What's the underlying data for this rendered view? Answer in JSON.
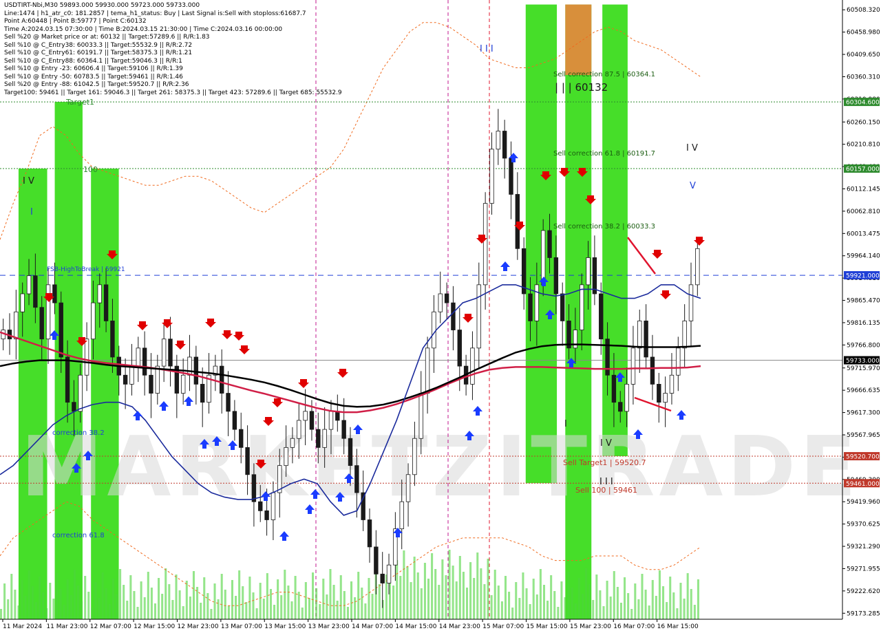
{
  "info": {
    "lines": [
      "USDTIRT-Nbi,M30  59893.000 59930.000 59723.000 59733.000",
      "Line:1474 | h1_atr_c0: 181.2857 | tema_h1_status: Buy | Last Signal is:Sell with stoploss:61687.7",
      "Point A:60448 | Point B:59777 | Point C:60132",
      "Time A:2024.03.15 07:30:00 | Time B:2024.03.15 21:30:00 | Time C:2024.03.16 00:00:00",
      "Sell %20 @ Market price or at: 60132 || Target:57289.6 || R/R:1.83",
      "Sell %10 @ C_Entry38: 60033.3 || Target:55532.9 || R/R:2.72",
      "Sell %10 @ C_Entry61: 60191.7 || Target:58375.3 || R/R:1.21",
      "Sell %10 @ C_Entry88: 60364.1 || Target:59046.3 || R/R:1",
      "Sell %10 @ Entry -23: 60606.4 || Target:59106 || R/R:1.39",
      "Sell %10 @ Entry -50: 60783.5 || Target:59461 || R/R:1.46",
      "Sell %20 @ Entry -88: 61042.5 || Target:59520.7 || R/R:2.36",
      "Target100: 59461 || Target 161: 59046.3 || Target 261: 58375.3 || Target 423: 57289.6 || Target 685: 55532.9"
    ]
  },
  "watermark": "MARKETZITRADE",
  "labels": {
    "fsb": "FSB-HighToBreak | 59921",
    "sell_corr_875": "Sell correction 87.5 | 60364.1",
    "big_abc": "| | | 60132",
    "sell_corr_618": "Sell correction 61.8 | 60191.7",
    "sell_corr_382": "Sell correction 38.2 | 60033.3",
    "sell_target1": "Sell Target1 | 59520.7",
    "sell_100": "Sell 100 | 59461",
    "corr_382": "correction 38.2",
    "corr_618": "correction 61.8",
    "target1": "Target1",
    "hundred": "100",
    "wave_iv_left": "I V",
    "wave_i_left": "I",
    "wave_iii_top": "I I I",
    "wave_iv_right": "I V",
    "wave_v_right": "V",
    "wave_i_mid": "I",
    "wave_iv_mid": "I V",
    "wave_iii_mid": "I I I"
  },
  "chart_data": {
    "type": "candlestick",
    "symbol": "USDTIRT-Nbi",
    "timeframe": "M30",
    "ohlc_last": {
      "open": 59893.0,
      "high": 59930.0,
      "low": 59723.0,
      "close": 59733.0
    },
    "ylim": [
      59160,
      60530
    ],
    "y_ticks": [
      60508.32,
      60458.98,
      60409.65,
      60360.31,
      60310.98,
      60260.15,
      60210.81,
      60161.48,
      60112.145,
      60062.81,
      60013.475,
      59964.14,
      59914.81,
      59865.47,
      59816.135,
      59766.8,
      59715.97,
      59666.635,
      59617.3,
      59567.965,
      59518.63,
      59469.3,
      59419.96,
      59370.625,
      59321.29,
      59271.955,
      59222.62,
      59173.285
    ],
    "y_tick_labels": [
      "60508.320",
      "60458.980",
      "60409.650",
      "60360.310",
      "60310.980",
      "60260.150",
      "60210.810",
      "60161.480",
      "60112.145",
      "60062.810",
      "60013.475",
      "59964.140",
      "59914.810",
      "59865.470",
      "59816.135",
      "59766.800",
      "59715.970",
      "59666.635",
      "59617.300",
      "59567.965",
      "59518.630",
      "59469.300",
      "59419.960",
      "59370.625",
      "59321.290",
      "59271.955",
      "59222.620",
      "59173.285"
    ],
    "x_tick_labels": [
      "11 Mar 2024",
      "11 Mar 23:00",
      "12 Mar 07:00",
      "12 Mar 15:00",
      "12 Mar 23:00",
      "13 Mar 07:00",
      "13 Mar 15:00",
      "13 Mar 23:00",
      "14 Mar 07:00",
      "14 Mar 15:00",
      "14 Mar 23:00",
      "15 Mar 07:00",
      "15 Mar 15:00",
      "15 Mar 23:00",
      "16 Mar 07:00",
      "16 Mar 15:00"
    ],
    "price_tags": [
      {
        "value": 60304.6,
        "label": "60304.600",
        "color": "#2e8b2e"
      },
      {
        "value": 60157.0,
        "label": "60157.000",
        "color": "#2e8b2e"
      },
      {
        "value": 59921.0,
        "label": "59921.000",
        "color": "#1f3fd6"
      },
      {
        "value": 59733.0,
        "label": "59733.000",
        "color": "#000000"
      },
      {
        "value": 59520.7,
        "label": "59520.700",
        "color": "#c0392b"
      },
      {
        "value": 59461.0,
        "label": "59461.000",
        "color": "#c0392b"
      }
    ],
    "levels": [
      {
        "value": 60304.6,
        "color": "#2e8b2e",
        "style": "dotted"
      },
      {
        "value": 60157.0,
        "color": "#2e8b2e",
        "style": "dotted"
      },
      {
        "value": 59921.0,
        "color": "#1f3fd6",
        "style": "dashed"
      },
      {
        "value": 59733.0,
        "color": "#888888",
        "style": "solid"
      },
      {
        "value": 59520.7,
        "color": "#c0392b",
        "style": "dotted"
      },
      {
        "value": 59461.0,
        "color": "#c0392b",
        "style": "dotted"
      }
    ],
    "series": [
      {
        "name": "close",
        "values": [
          59800,
          59780,
          59840,
          59880,
          59920,
          59850,
          59780,
          59900,
          59860,
          59740,
          59640,
          59620,
          59700,
          59780,
          59860,
          59900,
          59820,
          59740,
          59700,
          59680,
          59720,
          59760,
          59700,
          59660,
          59720,
          59780,
          59720,
          59660,
          59700,
          59740,
          59680,
          59640,
          59700,
          59720,
          59660,
          59620,
          59580,
          59540,
          59480,
          59420,
          59400,
          59380,
          59440,
          59500,
          59540,
          59560,
          59600,
          59620,
          59580,
          59540,
          59580,
          59620,
          59600,
          59560,
          59500,
          59440,
          59380,
          59320,
          59260,
          59240,
          59280,
          59360,
          59420,
          59480,
          59560,
          59660,
          59760,
          59840,
          59880,
          59860,
          59800,
          59720,
          59680,
          59760,
          59900,
          60080,
          60200,
          60240,
          60180,
          60100,
          59980,
          59880,
          59820,
          59900,
          60020,
          59960,
          59880,
          59820,
          59760,
          59800,
          59900,
          59960,
          59880,
          59780,
          59700,
          59640,
          59620,
          59680,
          59760,
          59820,
          59740,
          59680,
          59640,
          59660,
          59700,
          59760,
          59820,
          59900,
          59980
        ]
      },
      {
        "name": "ma_black",
        "values": [
          59720,
          59726,
          59730,
          59733,
          59733,
          59733,
          59730,
          59727,
          59723,
          59720,
          59718,
          59716,
          59714,
          59712,
          59710,
          59707,
          59704,
          59700,
          59695,
          59690,
          59684,
          59676,
          59667,
          59657,
          59647,
          59638,
          59632,
          59630,
          59631,
          59635,
          59642,
          59651,
          59661,
          59672,
          59685,
          59698,
          59712,
          59725,
          59738,
          59750,
          59758,
          59764,
          59767,
          59768,
          59768,
          59767,
          59766,
          59765,
          59763,
          59762,
          59762,
          59762,
          59763,
          59765
        ]
      },
      {
        "name": "ma_red",
        "values": [
          59795,
          59785,
          59775,
          59765,
          59755,
          59745,
          59737,
          59731,
          59727,
          59724,
          59721,
          59718,
          59714,
          59709,
          59704,
          59698,
          59690,
          59682,
          59674,
          59666,
          59659,
          59651,
          59643,
          59635,
          59627,
          59621,
          59618,
          59618,
          59622,
          59628,
          59636,
          59646,
          59657,
          59669,
          59682,
          59694,
          59704,
          59712,
          59716,
          59718,
          59718,
          59718,
          59717,
          59716,
          59715,
          59714,
          59714,
          59714,
          59715,
          59715,
          59716,
          59716,
          59717,
          59720
        ]
      },
      {
        "name": "ma_blue",
        "values": [
          59480,
          59500,
          59530,
          59560,
          59590,
          59610,
          59625,
          59635,
          59640,
          59640,
          59630,
          59600,
          59560,
          59520,
          59490,
          59460,
          59440,
          59430,
          59425,
          59425,
          59432,
          59445,
          59460,
          59470,
          59460,
          59420,
          59390,
          59400,
          59460,
          59530,
          59600,
          59680,
          59760,
          59800,
          59830,
          59860,
          59870,
          59885,
          59900,
          59900,
          59890,
          59880,
          59875,
          59880,
          59890,
          59890,
          59880,
          59870,
          59870,
          59880,
          59900,
          59900,
          59880,
          59870
        ]
      },
      {
        "name": "channel_upper",
        "values": [
          60000,
          60080,
          60150,
          60230,
          60250,
          60230,
          60190,
          60160,
          60150,
          60140,
          60130,
          60120,
          60120,
          60130,
          60140,
          60140,
          60130,
          60110,
          60090,
          60070,
          60060,
          60080,
          60100,
          60120,
          60140,
          60160,
          60200,
          60260,
          60320,
          60380,
          60420,
          60460,
          60480,
          60480,
          60470,
          60450,
          60430,
          60400,
          60390,
          60380,
          60380,
          60390,
          60400,
          60420,
          60440,
          60460,
          60470,
          60460,
          60440,
          60430,
          60420,
          60400,
          60380,
          60360
        ]
      },
      {
        "name": "channel_lower",
        "values": [
          59300,
          59340,
          59360,
          59380,
          59400,
          59420,
          59410,
          59380,
          59360,
          59340,
          59320,
          59300,
          59280,
          59260,
          59240,
          59220,
          59200,
          59190,
          59190,
          59200,
          59210,
          59220,
          59220,
          59210,
          59200,
          59190,
          59190,
          59200,
          59220,
          59240,
          59260,
          59280,
          59300,
          59320,
          59330,
          59340,
          59340,
          59340,
          59340,
          59330,
          59320,
          59300,
          59290,
          59290,
          59290,
          59300,
          59300,
          59300,
          59280,
          59270,
          59270,
          59280,
          59300,
          59320
        ]
      }
    ],
    "zones": [
      {
        "x0": 0.022,
        "x1": 0.056,
        "y0": 60157.0,
        "y1": 59160,
        "color": "#3cdc1e"
      },
      {
        "x0": 0.065,
        "x1": 0.098,
        "y0": 60304.6,
        "y1": 59160,
        "color": "#3cdc1e"
      },
      {
        "x0": 0.108,
        "x1": 0.141,
        "y0": 60157.0,
        "y1": 59160,
        "color": "#3cdc1e"
      },
      {
        "x0": 0.624,
        "x1": 0.661,
        "y0": 60520,
        "y1": 59461,
        "color": "#3cdc1e"
      },
      {
        "x0": 0.671,
        "x1": 0.702,
        "y0": 60520,
        "y1": 59160,
        "color": "#3cdc1e"
      },
      {
        "x0": 0.715,
        "x1": 0.745,
        "y0": 60520,
        "y1": 59520.7,
        "color": "#3cdc1e"
      },
      {
        "x0": 0.671,
        "x1": 0.702,
        "y0": 60520,
        "y1": 60364.1,
        "color": "#e08a3c"
      }
    ]
  }
}
